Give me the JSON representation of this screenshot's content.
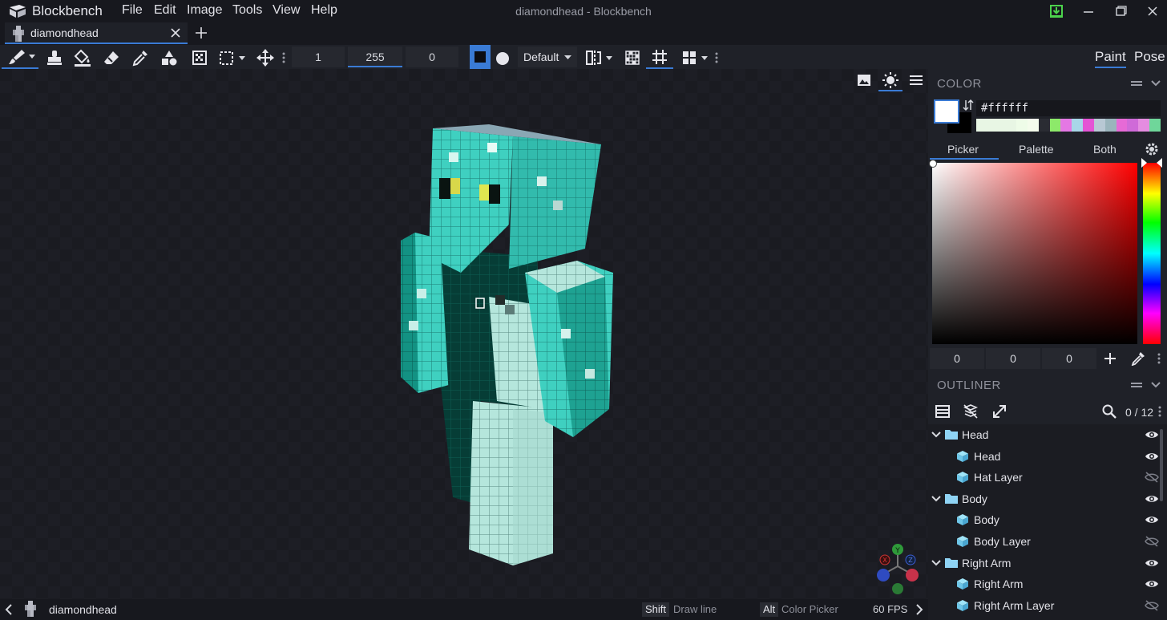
{
  "app": {
    "name": "Blockbench",
    "window_title": "diamondhead - Blockbench"
  },
  "menu": [
    "File",
    "Edit",
    "Image",
    "Tools",
    "View",
    "Help"
  ],
  "tabs": [
    {
      "label": "diamondhead"
    }
  ],
  "toolbar": {
    "brush_size": "1",
    "opacity": "255",
    "softness": "0",
    "blend_mode": "Default"
  },
  "modes": {
    "paint": "Paint",
    "pose": "Pose"
  },
  "color_panel": {
    "title": "COLOR",
    "hex": "#ffffff",
    "main_color": "#ffffff",
    "secondary_color": "#000000",
    "tabs": [
      "Picker",
      "Palette",
      "Both"
    ],
    "recent_colors": [
      "#e8f6e4",
      "#eefce8",
      "#f4fcec",
      "#2a2c33",
      "#8de96a",
      "#e478e4",
      "#a8d6e8",
      "#e454d4",
      "#b8c8d4",
      "#9ab4bc",
      "#e66ad6",
      "#cf6ad8",
      "#e58ce0",
      "#6fd69a"
    ],
    "rgb": [
      "0",
      "0",
      "0"
    ]
  },
  "outliner": {
    "title": "OUTLINER",
    "count": "0 / 12",
    "items": [
      {
        "type": "group",
        "name": "Head",
        "visible": true
      },
      {
        "type": "cube",
        "name": "Head",
        "visible": true
      },
      {
        "type": "cube",
        "name": "Hat Layer",
        "visible": false
      },
      {
        "type": "group",
        "name": "Body",
        "visible": true
      },
      {
        "type": "cube",
        "name": "Body",
        "visible": true
      },
      {
        "type": "cube",
        "name": "Body Layer",
        "visible": false
      },
      {
        "type": "group",
        "name": "Right Arm",
        "visible": true
      },
      {
        "type": "cube",
        "name": "Right Arm",
        "visible": true
      },
      {
        "type": "cube",
        "name": "Right Arm Layer",
        "visible": false
      }
    ]
  },
  "status": {
    "project": "diamondhead",
    "shift_key": "Shift",
    "shift_hint": "Draw line",
    "alt_key": "Alt",
    "alt_hint": "Color Picker",
    "fps": "60 FPS"
  },
  "gizmo": {
    "x": "X",
    "y": "Y",
    "z": "Z"
  }
}
